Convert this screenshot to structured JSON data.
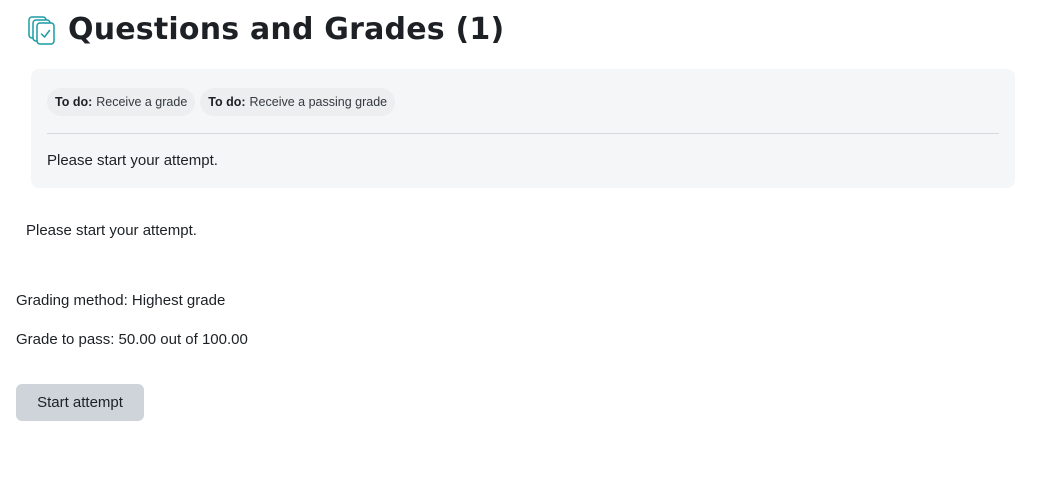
{
  "header": {
    "title": "Questions and Grades (1)",
    "icon": "quiz-icon",
    "icon_color": "#1a9ba3"
  },
  "activity_info": {
    "badges": [
      {
        "prefix": "To do:",
        "text": "Receive a grade"
      },
      {
        "prefix": "To do:",
        "text": "Receive a passing grade"
      }
    ],
    "message": "Please start your attempt."
  },
  "main": {
    "intro": "Please start your attempt.",
    "grading_method": "Grading method: Highest grade",
    "grade_to_pass": "Grade to pass: 50.00 out of 100.00",
    "start_button_label": "Start attempt"
  }
}
